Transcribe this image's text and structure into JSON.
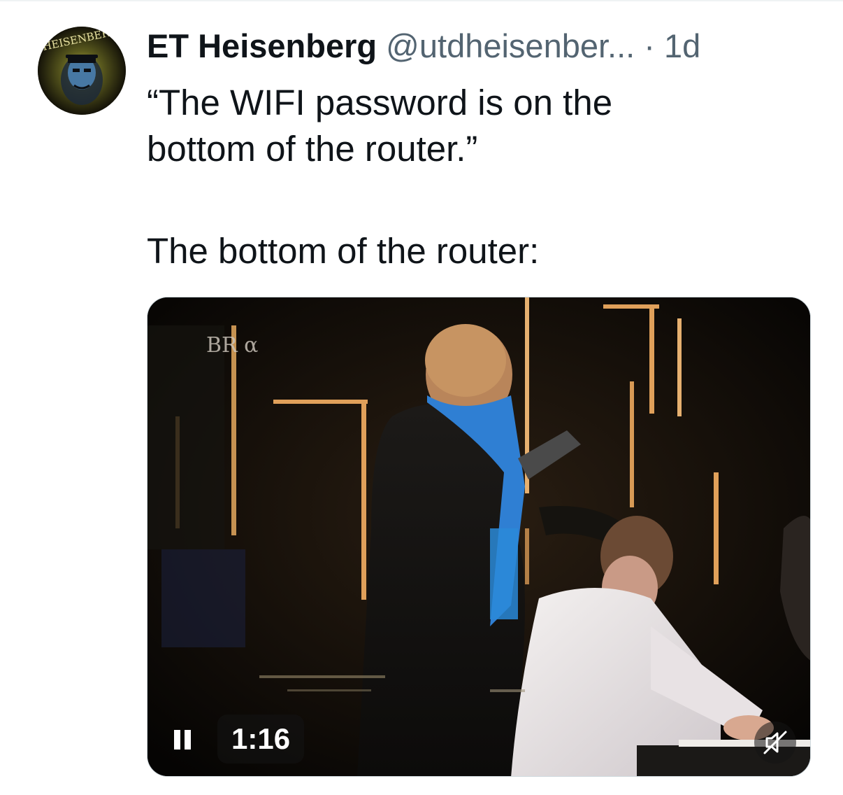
{
  "tweet": {
    "author": {
      "display_name": "ET Heisenberg",
      "handle": "@utdheisenber...",
      "avatar_icon": "profile-avatar-heisenberg",
      "avatar_caption": "HEISENBERG"
    },
    "separator": "·",
    "timestamp": "1d",
    "text_lines": [
      "“The WIFI password is on the",
      "bottom of the router.”",
      "The bottom of the router:"
    ]
  },
  "video": {
    "channel_logo": "BR α",
    "duration_label": "1:16",
    "pause_icon": "pause-icon",
    "mute_icon": "speaker-muted-icon",
    "state": "playing"
  },
  "colors": {
    "text_primary": "#0f1419",
    "text_secondary": "#536471",
    "border": "#cfd9de"
  }
}
